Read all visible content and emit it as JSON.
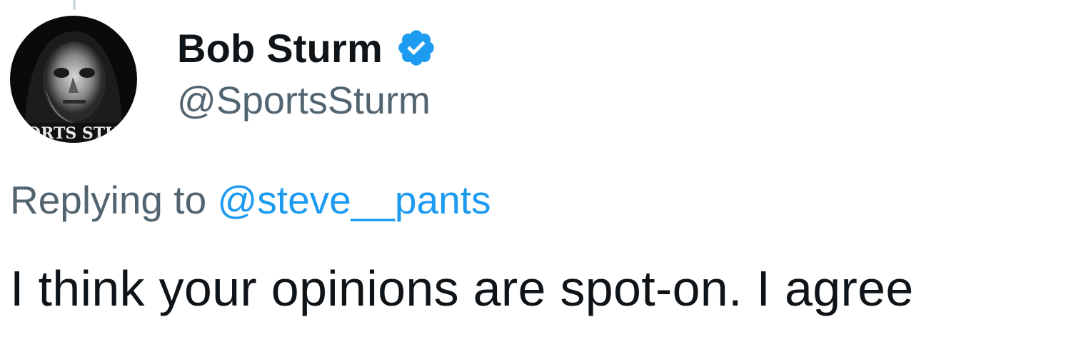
{
  "author": {
    "display_name": "Bob Sturm",
    "handle": "@SportsSturm",
    "verified": true,
    "avatar_text": "PORTS STUR"
  },
  "reply": {
    "prefix": "Replying to",
    "handle": "@steve__pants"
  },
  "tweet": {
    "text": "I think your opinions are spot-on. I agree"
  },
  "colors": {
    "name": "#0f1419",
    "secondary": "#536471",
    "link": "#1d9bf0",
    "verified_badge": "#1d9bf0",
    "thread_line": "#cfd9de"
  },
  "icons": {
    "verified": "verified-badge-icon"
  }
}
